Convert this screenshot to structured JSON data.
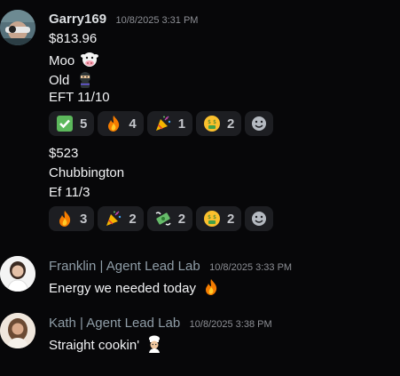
{
  "messages": [
    {
      "author": "Garry169",
      "timestamp": "10/8/2025 3:31 PM",
      "lines": [
        "$813.96",
        "Moo",
        "Old",
        "EFT 11/10"
      ],
      "reactions": [
        {
          "icon": "check-mark-icon",
          "count": "5"
        },
        {
          "icon": "fire-icon",
          "count": "4"
        },
        {
          "icon": "party-popper-icon",
          "count": "1"
        },
        {
          "icon": "money-mouth-face-icon",
          "count": "2"
        }
      ],
      "lines2": [
        "$523",
        "Chubbington",
        "Ef 11/3"
      ],
      "reactions2": [
        {
          "icon": "fire-icon",
          "count": "3"
        },
        {
          "icon": "party-popper-icon",
          "count": "2"
        },
        {
          "icon": "money-with-wings-icon",
          "count": "2"
        },
        {
          "icon": "money-mouth-face-icon",
          "count": "2"
        }
      ]
    },
    {
      "author": "Franklin | Agent Lead Lab",
      "timestamp": "10/8/2025 3:33 PM",
      "text": "Energy we needed today"
    },
    {
      "author": "Kath | Agent Lead Lab",
      "timestamp": "10/8/2025 3:38 PM",
      "text": "Straight cookin'"
    }
  ],
  "colors": {
    "background": "#070709",
    "reaction_bg": "#1d1e22",
    "author_primary": "#f2f3f5",
    "author_secondary": "#8f9da7"
  }
}
